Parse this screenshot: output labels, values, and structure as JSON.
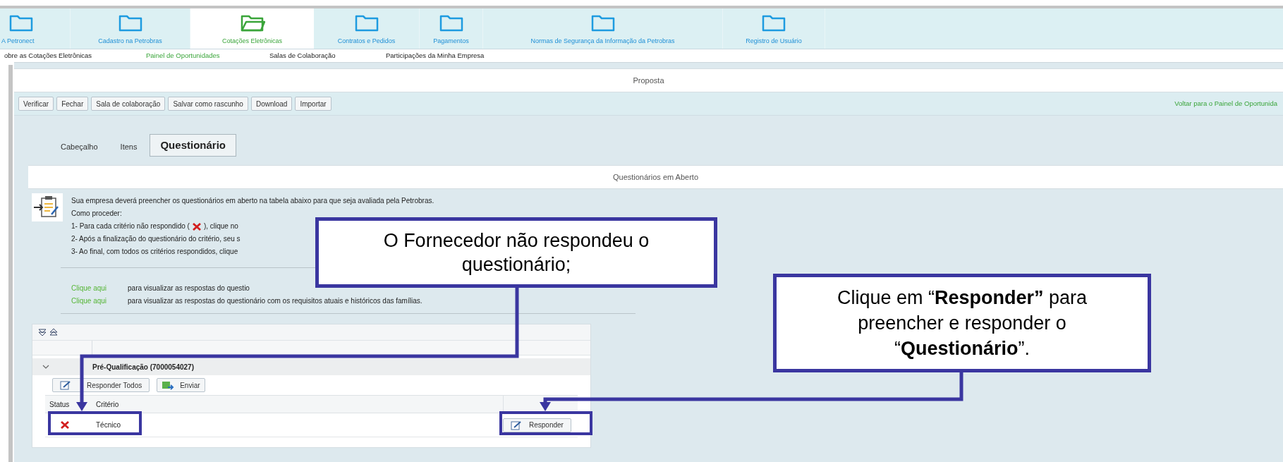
{
  "nav_tabs": [
    {
      "label": "A Petronect",
      "selected": false
    },
    {
      "label": "Cadastro na Petrobras",
      "selected": false
    },
    {
      "label": "Cotações Eletrônicas",
      "selected": true
    },
    {
      "label": "Contratos e Pedidos",
      "selected": false
    },
    {
      "label": "Pagamentos",
      "selected": false
    },
    {
      "label": "Normas de Segurança da Informação da Petrobras",
      "selected": false
    },
    {
      "label": "Registro de Usuário",
      "selected": false
    }
  ],
  "sub_nav": [
    {
      "label": "obre as Cotações Eletrônicas",
      "selected": false
    },
    {
      "label": "Painel de Oportunidades",
      "selected": true
    },
    {
      "label": "Salas de Colaboração",
      "selected": false
    },
    {
      "label": "Participações da Minha Empresa",
      "selected": false
    }
  ],
  "page_title": "Proposta",
  "toolbar": {
    "buttons": [
      "Verificar",
      "Fechar",
      "Sala de colaboração",
      "Salvar como rascunho",
      "Download",
      "Importar"
    ],
    "back_link": "Voltar para o Painel de Oportunida"
  },
  "tabs": [
    {
      "label": "Cabeçalho",
      "selected": false
    },
    {
      "label": "Itens",
      "selected": false
    },
    {
      "label": "Questionário",
      "selected": true
    }
  ],
  "section_title": "Questionários em Aberto",
  "instructions": {
    "intro": "Sua empresa deverá preencher os questionários em aberto na tabela abaixo para que seja avaliada pela Petrobras.",
    "how_to": "Como proceder:",
    "steps": [
      {
        "kind": "with_icon",
        "text": "1- Para cada critério não respondido (",
        "after": "), clique no"
      },
      {
        "kind": "plain",
        "text": "2- Após a finalização do questionário do critério, seu s"
      },
      {
        "kind": "plain",
        "text": "3- Ao final, com todos os critérios respondidos, clique"
      }
    ],
    "links": [
      {
        "link": "Clique aqui",
        "text": "para visualizar as respostas do questio"
      },
      {
        "link": "Clique aqui",
        "text": "para visualizar as respostas do questionário com os requisitos atuais e históricos das famílias."
      }
    ]
  },
  "table": {
    "group": "Pré-Qualificação (7000054027)",
    "expanded": true,
    "actions": [
      "Responder Todos",
      "Enviar"
    ],
    "columns": [
      "Status",
      "Critério"
    ],
    "rows": [
      {
        "kind": "unanswered",
        "criterion": "Técnico",
        "action": "Responder"
      }
    ]
  },
  "callouts": [
    {
      "text": "O Fornecedor não respondeu o questionário;"
    },
    {
      "text": "Clique em “**Responder”** para preencher e responder o “**Questionário**”."
    }
  ]
}
